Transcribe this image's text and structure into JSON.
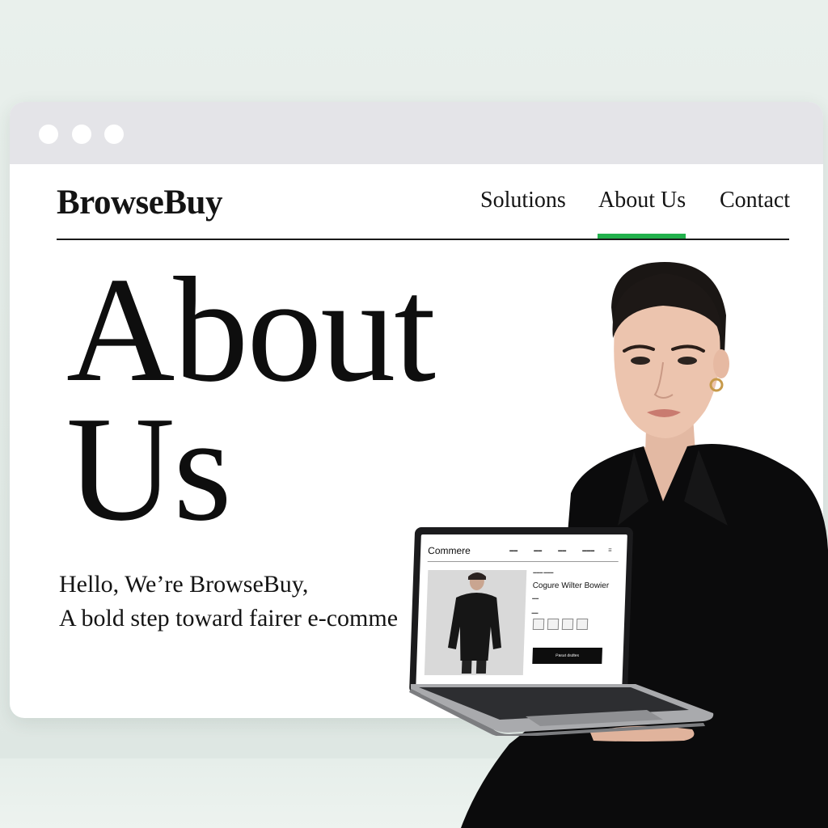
{
  "window": {
    "controls": [
      "window-dot",
      "window-dot",
      "window-dot"
    ]
  },
  "site": {
    "brand": "BrowseBuy",
    "nav": {
      "solutions": "Solutions",
      "about": "About Us",
      "contact": "Contact",
      "active": "About Us"
    },
    "accent_color": "#22b14c"
  },
  "hero": {
    "title_line1": "About",
    "title_line2": "Us",
    "subtitle_line1": "Hello, We’re BrowseBuy,",
    "subtitle_line2": "A bold step toward fairer e-comme"
  },
  "laptop_screen": {
    "brand": "Commere",
    "product_title": "Cogure Wilter Bowier",
    "button_label": "Pasut dsdtes"
  }
}
